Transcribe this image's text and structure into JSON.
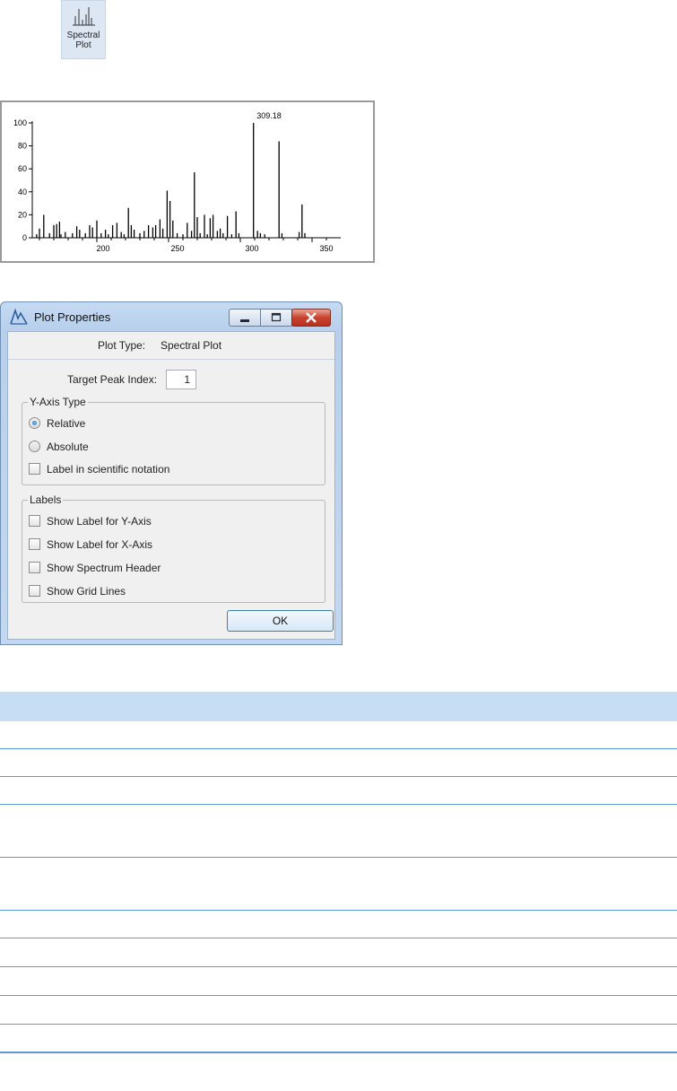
{
  "ribbon": {
    "button_label": "Spectral\nPlot"
  },
  "spectrum": {
    "top_peak_label": "309.18",
    "y_ticks": [
      "100",
      "80",
      "60",
      "40",
      "20",
      "0"
    ],
    "x_ticks": [
      "200",
      "250",
      "300",
      "350"
    ]
  },
  "chart_data": {
    "type": "bar",
    "xlim": [
      155,
      370
    ],
    "ylim": [
      0,
      100
    ],
    "x_ticks": [
      200,
      250,
      300,
      350
    ],
    "y_ticks": [
      0,
      20,
      40,
      60,
      80,
      100
    ],
    "annotation": {
      "x": 309.18,
      "text": "309.18"
    },
    "peaks": [
      [
        158,
        3
      ],
      [
        160,
        8
      ],
      [
        163,
        20
      ],
      [
        167,
        4
      ],
      [
        170,
        11
      ],
      [
        172,
        12
      ],
      [
        174,
        14
      ],
      [
        175,
        3
      ],
      [
        178,
        5
      ],
      [
        183,
        4
      ],
      [
        186,
        10
      ],
      [
        188,
        7
      ],
      [
        192,
        4
      ],
      [
        195,
        11
      ],
      [
        197,
        9
      ],
      [
        200,
        15
      ],
      [
        203,
        4
      ],
      [
        206,
        7
      ],
      [
        208,
        3
      ],
      [
        211,
        11
      ],
      [
        214,
        13
      ],
      [
        217,
        5
      ],
      [
        219,
        3
      ],
      [
        222,
        26
      ],
      [
        224,
        11
      ],
      [
        226,
        7
      ],
      [
        230,
        4
      ],
      [
        233,
        6
      ],
      [
        236,
        11
      ],
      [
        239,
        9
      ],
      [
        241,
        11
      ],
      [
        244,
        16
      ],
      [
        246,
        8
      ],
      [
        249,
        41
      ],
      [
        251,
        32
      ],
      [
        253,
        15
      ],
      [
        256,
        4
      ],
      [
        260,
        3
      ],
      [
        263,
        13
      ],
      [
        266,
        6
      ],
      [
        268,
        57
      ],
      [
        270,
        18
      ],
      [
        272,
        4
      ],
      [
        275,
        20
      ],
      [
        277,
        3
      ],
      [
        279,
        17
      ],
      [
        281,
        20
      ],
      [
        284,
        6
      ],
      [
        286,
        8
      ],
      [
        288,
        4
      ],
      [
        291,
        19
      ],
      [
        294,
        3
      ],
      [
        297,
        23
      ],
      [
        299,
        4
      ],
      [
        309.18,
        100
      ],
      [
        312,
        6
      ],
      [
        314,
        4
      ],
      [
        317,
        3
      ],
      [
        327,
        84
      ],
      [
        329,
        4
      ],
      [
        341,
        5
      ],
      [
        343,
        29
      ],
      [
        345,
        4
      ]
    ]
  },
  "dialog": {
    "title": "Plot Properties",
    "plot_type_label": "Plot Type:",
    "plot_type_value": "Spectral Plot",
    "target_peak_label": "Target Peak Index:",
    "target_peak_value": "1",
    "y_axis_group": {
      "legend": "Y-Axis Type",
      "relative": "Relative",
      "absolute": "Absolute",
      "scientific": "Label in scientific notation",
      "selected": "Relative"
    },
    "labels_group": {
      "legend": "Labels",
      "y_axis": "Show Label for Y-Axis",
      "x_axis": "Show Label for X-Axis",
      "spectrum_header": "Show Spectrum Header",
      "grid_lines": "Show Grid Lines"
    },
    "ok_label": "OK"
  }
}
